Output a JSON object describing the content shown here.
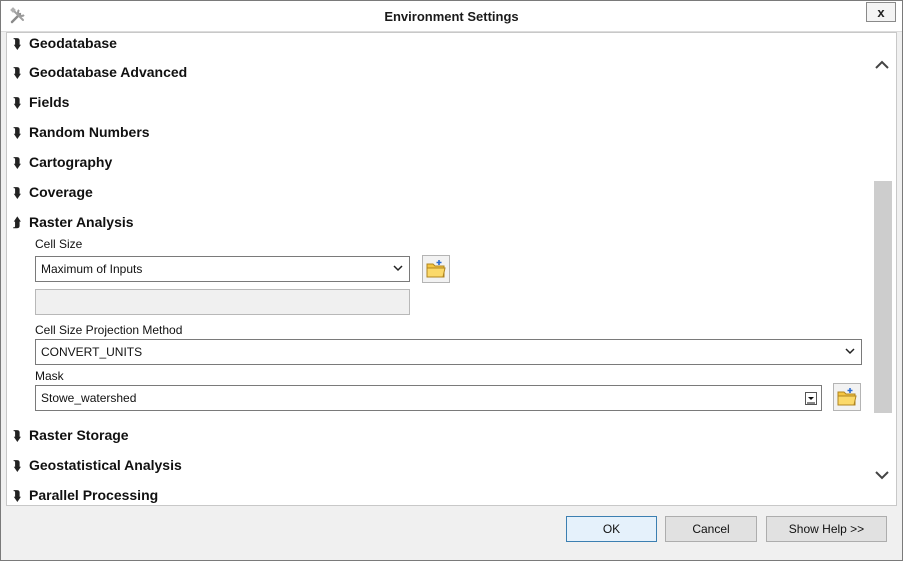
{
  "window": {
    "title": "Environment Settings",
    "close_label": "x"
  },
  "sections": [
    {
      "label": "Geodatabase",
      "expanded": false
    },
    {
      "label": "Geodatabase Advanced",
      "expanded": false
    },
    {
      "label": "Fields",
      "expanded": false
    },
    {
      "label": "Random Numbers",
      "expanded": false
    },
    {
      "label": "Cartography",
      "expanded": false
    },
    {
      "label": "Coverage",
      "expanded": false
    },
    {
      "label": "Raster Analysis",
      "expanded": true
    },
    {
      "label": "Raster Storage",
      "expanded": false
    },
    {
      "label": "Geostatistical Analysis",
      "expanded": false
    },
    {
      "label": "Parallel Processing",
      "expanded": false
    }
  ],
  "icons": {
    "collapsed": "chevron-double-down-icon",
    "expanded": "chevron-double-up-icon"
  },
  "raster_analysis": {
    "cell_size_label": "Cell Size",
    "cell_size_value": "Maximum of Inputs",
    "cell_size_text_value": "",
    "projection_method_label": "Cell Size Projection Method",
    "projection_method_value": "CONVERT_UNITS",
    "mask_label": "Mask",
    "mask_value": "Stowe_watershed"
  },
  "buttons": {
    "ok": "OK",
    "cancel": "Cancel",
    "help": "Show Help >>"
  }
}
